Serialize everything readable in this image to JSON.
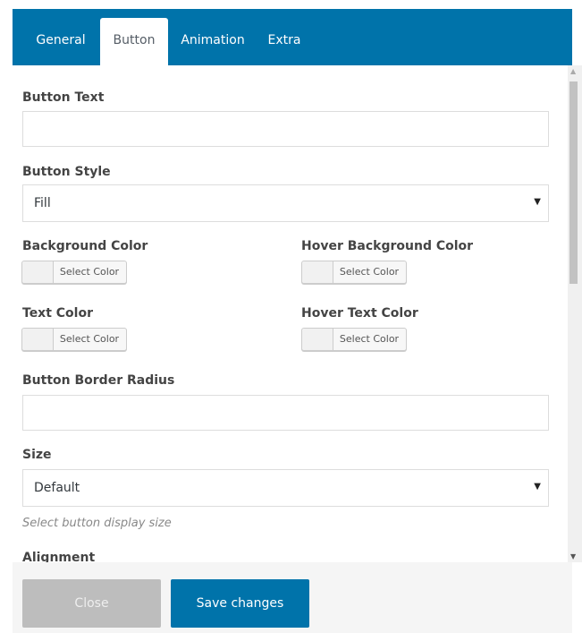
{
  "tabs": [
    {
      "label": "General"
    },
    {
      "label": "Button"
    },
    {
      "label": "Animation"
    },
    {
      "label": "Extra"
    }
  ],
  "active_tab": "Button",
  "fields": {
    "button_text": {
      "label": "Button Text",
      "value": ""
    },
    "button_style": {
      "label": "Button Style",
      "value": "Fill"
    },
    "background_color": {
      "label": "Background Color",
      "button": "Select Color"
    },
    "hover_background_color": {
      "label": "Hover Background Color",
      "button": "Select Color"
    },
    "text_color": {
      "label": "Text Color",
      "button": "Select Color"
    },
    "hover_text_color": {
      "label": "Hover Text Color",
      "button": "Select Color"
    },
    "border_radius": {
      "label": "Button Border Radius",
      "value": ""
    },
    "size": {
      "label": "Size",
      "value": "Default",
      "help": "Select button display size"
    },
    "alignment": {
      "label": "Alignment"
    }
  },
  "footer": {
    "close_label": "Close",
    "save_label": "Save changes"
  },
  "colors": {
    "header": "#0073aa",
    "save_button": "#0073aa",
    "close_button": "#bdbdbd"
  },
  "icons": {
    "select_arrow": "▼",
    "scroll_up": "▲",
    "scroll_down": "▼"
  }
}
